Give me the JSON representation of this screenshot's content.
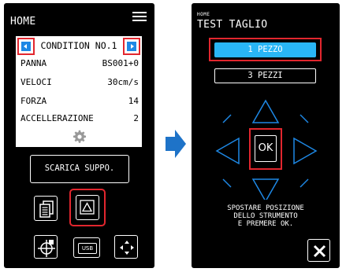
{
  "left_screen": {
    "title": "HOME",
    "menu_icon": "hamburger-menu-icon",
    "condition_label": "CONDITION NO.1",
    "params": [
      {
        "key": "PANNA",
        "value": "BS001+0"
      },
      {
        "key": "VELOCI",
        "value": "30cm/s"
      },
      {
        "key": "FORZA",
        "value": "14"
      },
      {
        "key": "ACCELLERAZIONE",
        "value": "2"
      }
    ],
    "feed_button_label": "SCARICA SUPPO.",
    "usb_label": "USB"
  },
  "right_screen": {
    "small_label": "HOME",
    "title": "TEST TAGLIO",
    "option_1_label": "1 PEZZO",
    "option_2_label": "3 PEZZI",
    "ok_label": "OK",
    "instructions": [
      "SPOSTARE POSIZIONE",
      "DELLO STRUMENTO",
      "E PREMERE OK."
    ]
  },
  "colors": {
    "accent": "#1e88e5",
    "highlight": "#e2262e",
    "selected": "#29b6f6"
  }
}
